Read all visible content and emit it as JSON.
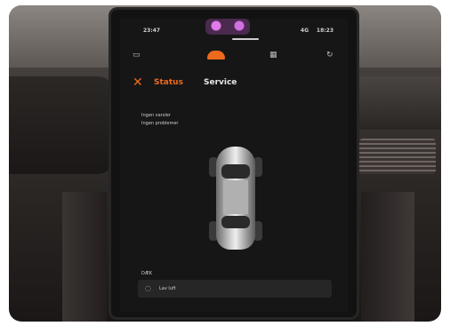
{
  "status_bar": {
    "left": "23:47",
    "right": "18:23",
    "signal": "4G"
  },
  "top_icons": {
    "left_icon": "camera-icon",
    "center_icon": "car-icon",
    "right_icon": "refresh-icon",
    "mid_icon": "grid-icon"
  },
  "tabs": [
    {
      "label": "Status",
      "active": true
    },
    {
      "label": "Service",
      "active": false
    }
  ],
  "status_lines": [
    "Ingen varsler",
    "Ingen problemer"
  ],
  "section": {
    "heading": "DÆK",
    "row_label": "Lav luft"
  },
  "colors": {
    "accent": "#ee6a1c",
    "screen_bg": "#161616"
  }
}
